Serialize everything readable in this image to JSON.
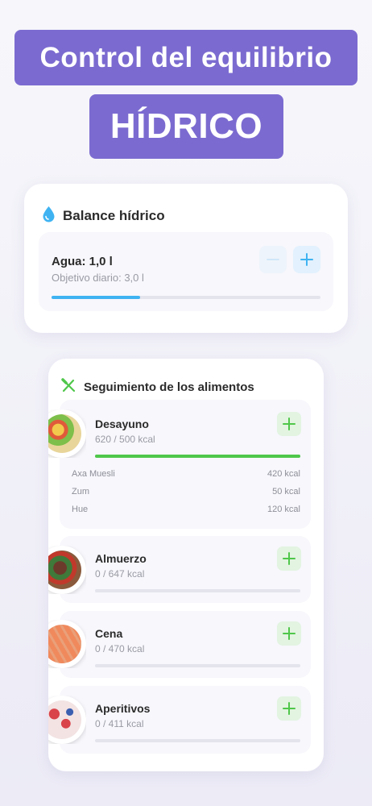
{
  "headline": {
    "line1": "Control del equilibrio",
    "line2": "HÍDRICO"
  },
  "colors": {
    "banner": "#7b6bd0",
    "water_accent": "#3fb3f2",
    "food_accent": "#4fc74a"
  },
  "water_card": {
    "title": "Balance hídrico",
    "icon": "water-drop-icon",
    "amount": "Agua: 1,0 l",
    "goal": "Objetivo diario: 3,0 l",
    "progress": 0.33
  },
  "food_card": {
    "title": "Seguimiento de los alimentos",
    "icon": "fork-knife-icon",
    "meals": [
      {
        "name": "Desayuno",
        "kcal": "620 / 500 kcal",
        "progress": 1.0,
        "items": [
          {
            "name": "Axa Muesli",
            "kcal": "420 kcal"
          },
          {
            "name": "Zum",
            "kcal": "50 kcal"
          },
          {
            "name": "Hue",
            "kcal": "120 kcal"
          }
        ]
      },
      {
        "name": "Almuerzo",
        "kcal": "0 / 647 kcal",
        "progress": 0
      },
      {
        "name": "Cena",
        "kcal": "0 / 470 kcal",
        "progress": 0
      },
      {
        "name": "Aperitivos",
        "kcal": "0 / 411 kcal",
        "progress": 0
      }
    ]
  }
}
